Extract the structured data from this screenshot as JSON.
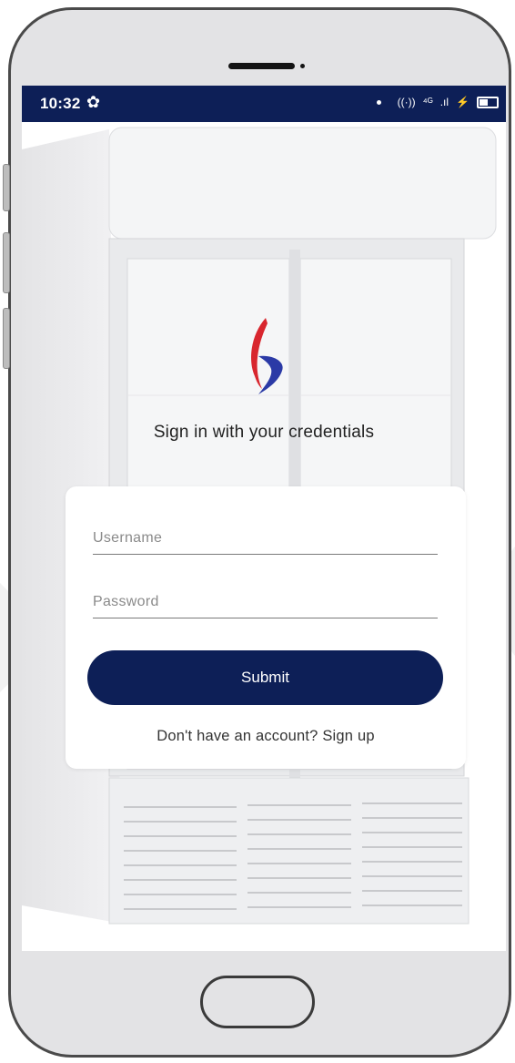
{
  "status_bar": {
    "time": "10:32",
    "settings_icon": "gear-icon",
    "indicators": [
      "dot-icon",
      "hotspot-icon",
      "signal-icon",
      "battery-icon"
    ],
    "hotspot_glyph": "((·))",
    "network_glyph": "⁴ᴳ",
    "signal_glyph": ".ıl",
    "charge_glyph": "⚡"
  },
  "login": {
    "logo_icon": "brand-logo",
    "subtitle": "Sign in with your credentials",
    "username_placeholder": "Username",
    "password_placeholder": "Password",
    "submit_label": "Submit",
    "signup_text": "Don't have an account? Sign up"
  },
  "colors": {
    "primary": "#0d1f57",
    "logo_red": "#d8262e",
    "logo_blue": "#2b3aa6"
  }
}
